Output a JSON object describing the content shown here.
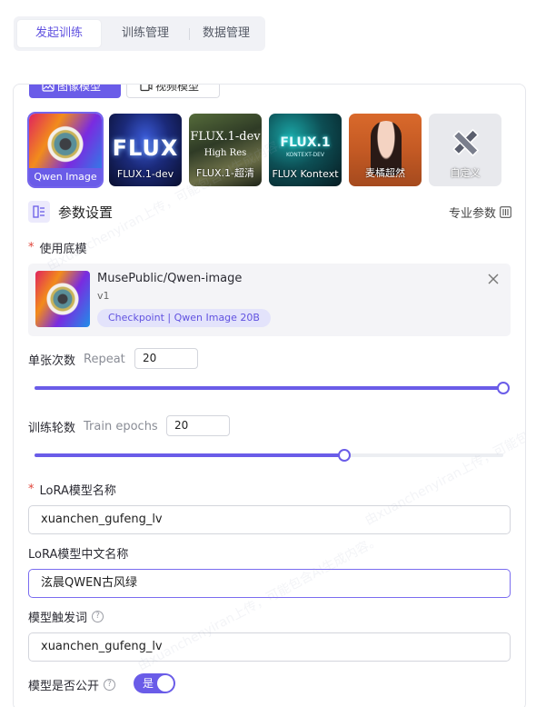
{
  "top_tabs": [
    {
      "label": "发起训练",
      "active": true
    },
    {
      "label": "训练管理",
      "active": false
    },
    {
      "label": "数据管理",
      "active": false
    }
  ],
  "model_types": [
    {
      "label": "图像模型",
      "active": true
    },
    {
      "label": "视频模型",
      "active": false
    }
  ],
  "model_tiles": [
    {
      "label": "Qwen Image",
      "selected": true
    },
    {
      "label": "FLUX.1-dev",
      "selected": false,
      "art_text": "FLUX"
    },
    {
      "label": "FLUX.1-超清",
      "selected": false,
      "art_text": "FLUX.1-dev",
      "art_sub": "High Res"
    },
    {
      "label": "FLUX Kontext",
      "selected": false,
      "art_text": "FLUX.1",
      "art_sub": "KONTEXT-DEV"
    },
    {
      "label": "麦橘超然",
      "selected": false
    },
    {
      "label": "自定义",
      "selected": false
    }
  ],
  "params_section": {
    "title": "参数设置",
    "pro_link": "专业参数"
  },
  "base_model": {
    "label": "使用底模",
    "required": true,
    "name": "MusePublic/Qwen-image",
    "version": "v1",
    "badge": "Checkpoint | Qwen Image 20B"
  },
  "repeat": {
    "label": "单张次数",
    "sublabel": "Repeat",
    "value": "20",
    "slider_fraction": 1.0
  },
  "epochs": {
    "label": "训练轮数",
    "sublabel": "Train epochs",
    "value": "20",
    "slider_fraction": 0.66
  },
  "lora_name": {
    "label": "LoRA模型名称",
    "required": true,
    "value": "xuanchen_gufeng_lv"
  },
  "lora_cn_name": {
    "label": "LoRA模型中文名称",
    "value": "泫晨QWEN古风绿"
  },
  "trigger_word": {
    "label": "模型触发词",
    "value": "xuanchen_gufeng_lv"
  },
  "public": {
    "label": "模型是否公开",
    "toggle_text": "是",
    "on": true
  },
  "watermark": "由xuanchenyiran上传，可能包含AI生成内容。",
  "colors": {
    "accent": "#6a5ce8",
    "required": "#e0453a"
  }
}
